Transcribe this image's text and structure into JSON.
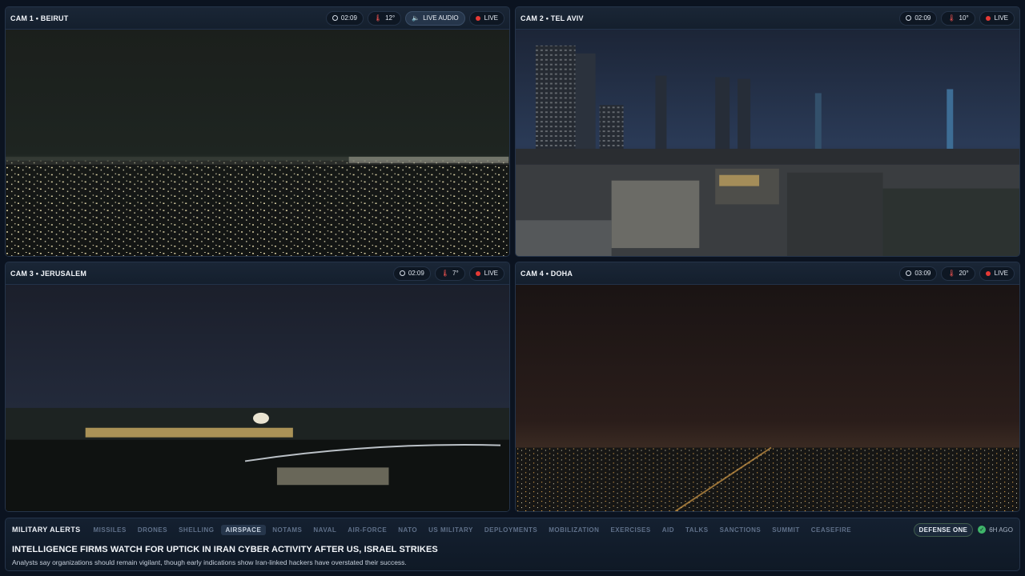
{
  "cameras": [
    {
      "title": "CAM 1 • BEIRUT",
      "time": "02:09",
      "temp": "12°",
      "audio": "LIVE AUDIO",
      "live": "LIVE"
    },
    {
      "title": "CAM 2 • TEL AVIV",
      "time": "02:09",
      "temp": "10°",
      "live": "LIVE"
    },
    {
      "title": "CAM 3 • JERUSALEM",
      "time": "02:09",
      "temp": "7°",
      "live": "LIVE"
    },
    {
      "title": "CAM 4 • DOHA",
      "time": "03:09",
      "temp": "20°",
      "live": "LIVE"
    }
  ],
  "ticker": {
    "lead": "MILITARY ALERTS",
    "tabs": [
      "MISSILES",
      "DRONES",
      "SHELLING",
      "AIRSPACE",
      "NOTAMS",
      "NAVAL",
      "AIR-FORCE",
      "NATO",
      "US MILITARY",
      "DEPLOYMENTS",
      "MOBILIZATION",
      "EXERCISES",
      "AID",
      "TALKS",
      "SANCTIONS",
      "SUMMIT",
      "CEASEFIRE"
    ],
    "active_tab": "AIRSPACE",
    "source": "DEFENSE ONE",
    "age": "6H AGO",
    "headline": "INTELLIGENCE FIRMS WATCH FOR UPTICK IN IRAN CYBER ACTIVITY AFTER US, ISRAEL STRIKES",
    "summary": "Analysts say organizations should remain vigilant, though early indications show Iran-linked hackers have overstated their success."
  },
  "colors": {
    "live_dot": "#e53935",
    "verified": "#3fb56a",
    "panel_bg": "#101a28"
  }
}
